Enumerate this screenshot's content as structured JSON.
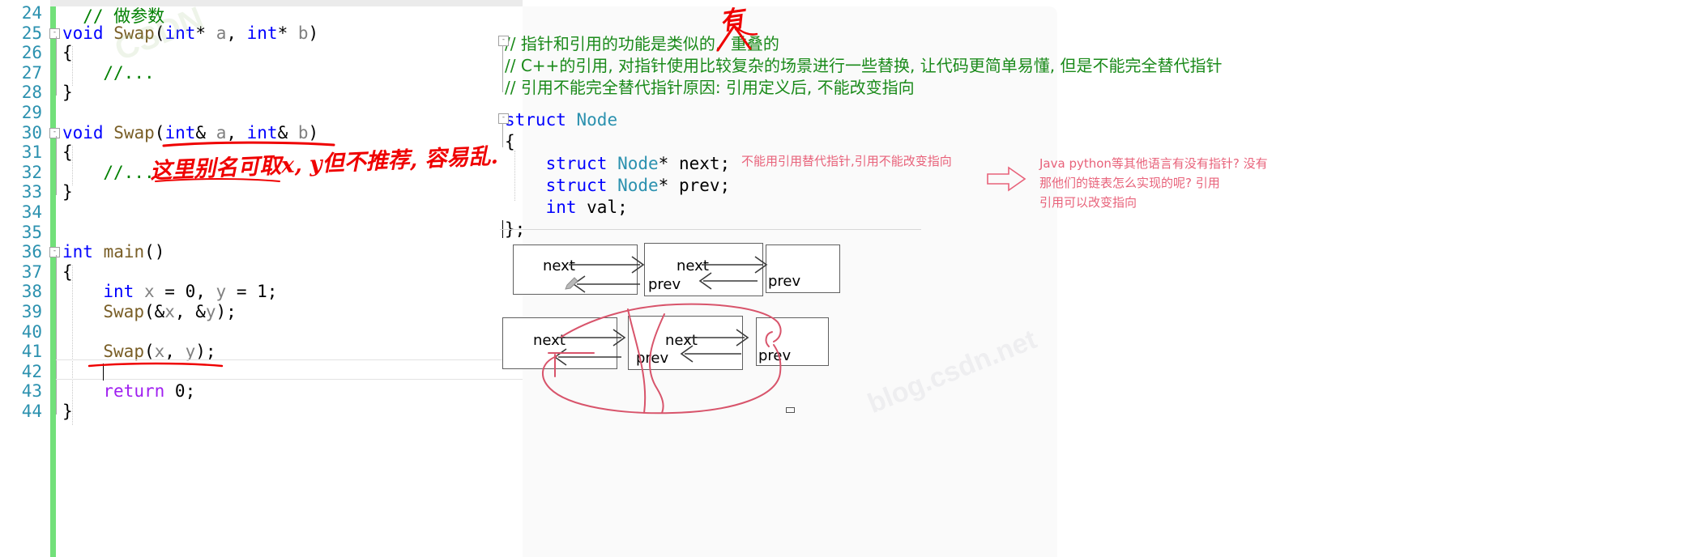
{
  "editor": {
    "language": "cpp",
    "lines": [
      {
        "no": "24",
        "indent": 1,
        "tokens": [
          {
            "t": "// 做参数",
            "c": "cmt"
          }
        ]
      },
      {
        "no": "25",
        "fold": true,
        "indent": 0,
        "tokens": [
          {
            "t": "void ",
            "c": "kw"
          },
          {
            "t": "Swap",
            "c": "fn"
          },
          {
            "t": "(",
            "c": "op"
          },
          {
            "t": "int",
            "c": "kw"
          },
          {
            "t": "* ",
            "c": "op"
          },
          {
            "t": "a",
            "c": "var"
          },
          {
            "t": ", ",
            "c": "op"
          },
          {
            "t": "int",
            "c": "kw"
          },
          {
            "t": "* ",
            "c": "op"
          },
          {
            "t": "b",
            "c": "var"
          },
          {
            "t": ")",
            "c": "op"
          }
        ]
      },
      {
        "no": "26",
        "indent": 0,
        "tokens": [
          {
            "t": "{",
            "c": "op"
          }
        ]
      },
      {
        "no": "27",
        "indent": 2,
        "tokens": [
          {
            "t": "//...",
            "c": "cmt"
          }
        ]
      },
      {
        "no": "28",
        "indent": 0,
        "tokens": [
          {
            "t": "}",
            "c": "op"
          }
        ]
      },
      {
        "no": "29",
        "indent": 0,
        "tokens": []
      },
      {
        "no": "30",
        "fold": true,
        "indent": 0,
        "tokens": [
          {
            "t": "void ",
            "c": "kw"
          },
          {
            "t": "Swap",
            "c": "fn"
          },
          {
            "t": "(",
            "c": "op"
          },
          {
            "t": "int",
            "c": "kw"
          },
          {
            "t": "& ",
            "c": "op"
          },
          {
            "t": "a",
            "c": "var"
          },
          {
            "t": ", ",
            "c": "op"
          },
          {
            "t": "int",
            "c": "kw"
          },
          {
            "t": "& ",
            "c": "op"
          },
          {
            "t": "b",
            "c": "var"
          },
          {
            "t": ")",
            "c": "op"
          }
        ]
      },
      {
        "no": "31",
        "indent": 0,
        "tokens": [
          {
            "t": "{",
            "c": "op"
          }
        ]
      },
      {
        "no": "32",
        "indent": 2,
        "tokens": [
          {
            "t": "//...",
            "c": "cmt"
          }
        ]
      },
      {
        "no": "33",
        "indent": 0,
        "tokens": [
          {
            "t": "}",
            "c": "op"
          }
        ]
      },
      {
        "no": "34",
        "indent": 0,
        "tokens": []
      },
      {
        "no": "35",
        "indent": 0,
        "tokens": []
      },
      {
        "no": "36",
        "fold": true,
        "indent": 0,
        "tokens": [
          {
            "t": "int ",
            "c": "kw"
          },
          {
            "t": "main",
            "c": "fn"
          },
          {
            "t": "()",
            "c": "op"
          }
        ]
      },
      {
        "no": "37",
        "indent": 0,
        "tokens": [
          {
            "t": "{",
            "c": "op"
          }
        ]
      },
      {
        "no": "38",
        "indent": 2,
        "tokens": [
          {
            "t": "int ",
            "c": "kw"
          },
          {
            "t": "x",
            "c": "var"
          },
          {
            "t": " = ",
            "c": "op"
          },
          {
            "t": "0",
            "c": "num"
          },
          {
            "t": ", ",
            "c": "op"
          },
          {
            "t": "y",
            "c": "var"
          },
          {
            "t": " = ",
            "c": "op"
          },
          {
            "t": "1",
            "c": "num"
          },
          {
            "t": ";",
            "c": "op"
          }
        ]
      },
      {
        "no": "39",
        "indent": 2,
        "tokens": [
          {
            "t": "Swap",
            "c": "fn"
          },
          {
            "t": "(&",
            "c": "op"
          },
          {
            "t": "x",
            "c": "var"
          },
          {
            "t": ", &",
            "c": "op"
          },
          {
            "t": "y",
            "c": "var"
          },
          {
            "t": ");",
            "c": "op"
          }
        ]
      },
      {
        "no": "40",
        "indent": 0,
        "tokens": []
      },
      {
        "no": "41",
        "indent": 2,
        "tokens": [
          {
            "t": "Swap",
            "c": "fn"
          },
          {
            "t": "(",
            "c": "op"
          },
          {
            "t": "x",
            "c": "var"
          },
          {
            "t": ", ",
            "c": "op"
          },
          {
            "t": "y",
            "c": "var"
          },
          {
            "t": ");",
            "c": "op"
          }
        ]
      },
      {
        "no": "42",
        "indent": 2,
        "current": true,
        "tokens": []
      },
      {
        "no": "43",
        "indent": 2,
        "tokens": [
          {
            "t": "return ",
            "c": "purple"
          },
          {
            "t": "0",
            "c": "num"
          },
          {
            "t": ";",
            "c": "op"
          }
        ]
      },
      {
        "no": "44",
        "indent": 0,
        "tokens": [
          {
            "t": "}",
            "c": "op"
          }
        ]
      }
    ]
  },
  "notes": {
    "comments": [
      "// 指针和引用的功能是类似的,  重叠的",
      "// C++的引用, 对指针使用比较复杂的场景进行一些替换, 让代码更简单易懂, 但是不能完全替代指针",
      "// 引用不能完全替代指针原因: 引用定义后, 不能改变指向"
    ],
    "struct_code": [
      "struct Node",
      "{",
      "    struct Node* next;",
      "    struct Node* prev;",
      "    int val;",
      "};"
    ]
  },
  "annotations": {
    "handwritten_swap": "这里别名可取x, y但不推荐, 容易乱.",
    "handwritten_you": "有",
    "red_note_struct": "不能用引用替代指针,引用不能改变指向",
    "red_note_right": [
      "Java python等其他语言有没有指针? 没有",
      "那他们的链表怎么实现的呢? 引用",
      "引用可以改变指向"
    ]
  },
  "diagram": {
    "top_row_labels": [
      "next",
      "next",
      "prev",
      "prev"
    ],
    "bottom_row_labels": [
      "next",
      "next",
      "prev",
      "prev"
    ]
  },
  "watermarks": [
    "CSDN",
    "blog.csdn.net"
  ],
  "colors": {
    "keyword": "#0000ff",
    "function": "#795e26",
    "type": "#2b91af",
    "comment": "#008000",
    "variable": "#808080",
    "line_number": "#2b91af",
    "change_bar": "#72e07a",
    "handwriting_red": "#ef0000",
    "annotation_red": "#e8627a",
    "note_background": "#fafafa"
  }
}
